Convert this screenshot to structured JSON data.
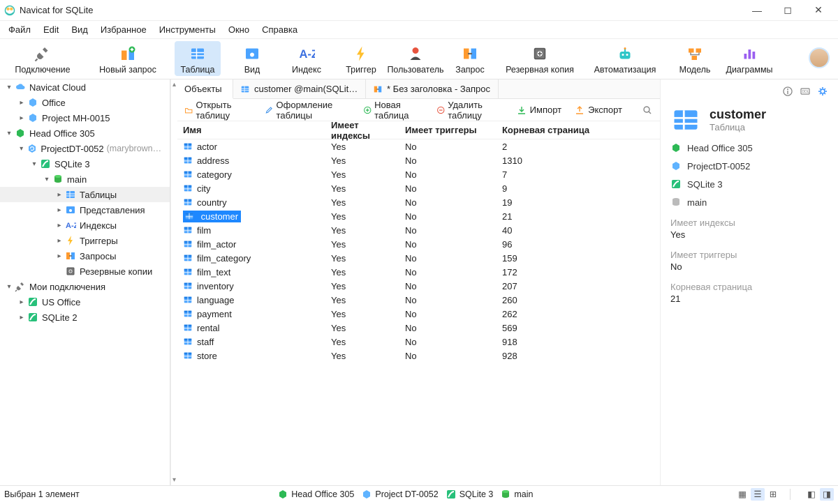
{
  "title": "Navicat for SQLite",
  "menubar": [
    "Файл",
    "Edit",
    "Вид",
    "Избранное",
    "Инструменты",
    "Окно",
    "Справка"
  ],
  "toolbar": {
    "items": [
      {
        "id": "connect",
        "label": "Подключение",
        "icon": "plug",
        "w": "wide"
      },
      {
        "id": "newquery",
        "label": "Новый запрос",
        "icon": "newquery",
        "w": "wide"
      },
      {
        "id": "table",
        "label": "Таблица",
        "icon": "table",
        "active": true
      },
      {
        "id": "view",
        "label": "Вид",
        "icon": "view"
      },
      {
        "id": "index",
        "label": "Индекс",
        "icon": "az"
      },
      {
        "id": "trigger",
        "label": "Триггер",
        "icon": "bolt"
      },
      {
        "id": "user",
        "label": "Пользователь",
        "icon": "user"
      },
      {
        "id": "query",
        "label": "Запрос",
        "icon": "query"
      },
      {
        "id": "backup",
        "label": "Резервная копия",
        "icon": "backup",
        "w": "wide"
      },
      {
        "id": "automation",
        "label": "Автоматизация",
        "icon": "robot",
        "w": "wide"
      },
      {
        "id": "model",
        "label": "Модель",
        "icon": "model"
      },
      {
        "id": "diagrams",
        "label": "Диаграммы",
        "icon": "chart"
      }
    ]
  },
  "tree": [
    {
      "depth": 0,
      "arrow": "down",
      "icon": "cloud",
      "label": "Navicat Cloud"
    },
    {
      "depth": 1,
      "arrow": "right",
      "icon": "hex",
      "label": "Office"
    },
    {
      "depth": 1,
      "arrow": "right",
      "icon": "hex",
      "label": "Project MH-0015"
    },
    {
      "depth": 0,
      "arrow": "down",
      "icon": "hexg",
      "label": "Head Office 305"
    },
    {
      "depth": 1,
      "arrow": "down",
      "icon": "hexsync",
      "label": "ProjectDT-0052",
      "aux": "(marybrown@…"
    },
    {
      "depth": 2,
      "arrow": "down",
      "icon": "sqlite",
      "label": "SQLite 3"
    },
    {
      "depth": 3,
      "arrow": "down",
      "icon": "db",
      "label": "main"
    },
    {
      "depth": 4,
      "arrow": "right",
      "icon": "tables",
      "label": "Таблицы",
      "selected": true
    },
    {
      "depth": 4,
      "arrow": "right",
      "icon": "views",
      "label": "Представления"
    },
    {
      "depth": 4,
      "arrow": "right",
      "icon": "az",
      "label": "Индексы"
    },
    {
      "depth": 4,
      "arrow": "right",
      "icon": "bolt",
      "label": "Триггеры"
    },
    {
      "depth": 4,
      "arrow": "right",
      "icon": "query",
      "label": "Запросы"
    },
    {
      "depth": 4,
      "arrow": "",
      "icon": "backup",
      "label": "Резервные копии"
    },
    {
      "depth": 0,
      "arrow": "down",
      "icon": "plug",
      "label": "Мои подключения"
    },
    {
      "depth": 1,
      "arrow": "right",
      "icon": "sqliteg",
      "label": "US Office"
    },
    {
      "depth": 1,
      "arrow": "right",
      "icon": "sqliteg",
      "label": "SQLite 2"
    }
  ],
  "tabs": [
    {
      "label": "Объекты",
      "icon": "",
      "active": true
    },
    {
      "label": "customer @main(SQLite 3…",
      "icon": "table"
    },
    {
      "label": "* Без заголовка - Запрос",
      "icon": "query"
    }
  ],
  "toolbar2": {
    "open": "Открыть таблицу",
    "design": "Оформление таблицы",
    "new": "Новая таблица",
    "delete": "Удалить таблицу",
    "import": "Импорт",
    "export": "Экспорт"
  },
  "grid": {
    "columns": {
      "name": "Имя",
      "idx": "Имеет индексы",
      "trig": "Имеет триггеры",
      "root": "Корневая страница"
    },
    "rows": [
      {
        "name": "actor",
        "idx": "Yes",
        "trig": "No",
        "root": "2"
      },
      {
        "name": "address",
        "idx": "Yes",
        "trig": "No",
        "root": "1310"
      },
      {
        "name": "category",
        "idx": "Yes",
        "trig": "No",
        "root": "7"
      },
      {
        "name": "city",
        "idx": "Yes",
        "trig": "No",
        "root": "9"
      },
      {
        "name": "country",
        "idx": "Yes",
        "trig": "No",
        "root": "19"
      },
      {
        "name": "customer",
        "idx": "Yes",
        "trig": "No",
        "root": "21",
        "selected": true
      },
      {
        "name": "film",
        "idx": "Yes",
        "trig": "No",
        "root": "40"
      },
      {
        "name": "film_actor",
        "idx": "Yes",
        "trig": "No",
        "root": "96"
      },
      {
        "name": "film_category",
        "idx": "Yes",
        "trig": "No",
        "root": "159"
      },
      {
        "name": "film_text",
        "idx": "Yes",
        "trig": "No",
        "root": "172"
      },
      {
        "name": "inventory",
        "idx": "Yes",
        "trig": "No",
        "root": "207"
      },
      {
        "name": "language",
        "idx": "Yes",
        "trig": "No",
        "root": "260"
      },
      {
        "name": "payment",
        "idx": "Yes",
        "trig": "No",
        "root": "262"
      },
      {
        "name": "rental",
        "idx": "Yes",
        "trig": "No",
        "root": "569"
      },
      {
        "name": "staff",
        "idx": "Yes",
        "trig": "No",
        "root": "918"
      },
      {
        "name": "store",
        "idx": "Yes",
        "trig": "No",
        "root": "928"
      }
    ]
  },
  "rpanel": {
    "name": "customer",
    "type": "Таблица",
    "meta": [
      {
        "icon": "hexg",
        "text": "Head Office 305"
      },
      {
        "icon": "hex",
        "text": "ProjectDT-0052"
      },
      {
        "icon": "sqlite",
        "text": "SQLite 3"
      },
      {
        "icon": "db2",
        "text": "main"
      }
    ],
    "props": [
      {
        "label": "Имеет индексы",
        "value": "Yes"
      },
      {
        "label": "Имеет триггеры",
        "value": "No"
      },
      {
        "label": "Корневая страница",
        "value": "21"
      }
    ]
  },
  "status": {
    "selection": "Выбран 1 элемент",
    "crumbs": [
      {
        "icon": "hexg",
        "text": "Head Office 305"
      },
      {
        "icon": "hex",
        "text": "Project DT-0052"
      },
      {
        "icon": "sqlite",
        "text": "SQLite 3"
      },
      {
        "icon": "db",
        "text": "main"
      }
    ]
  }
}
